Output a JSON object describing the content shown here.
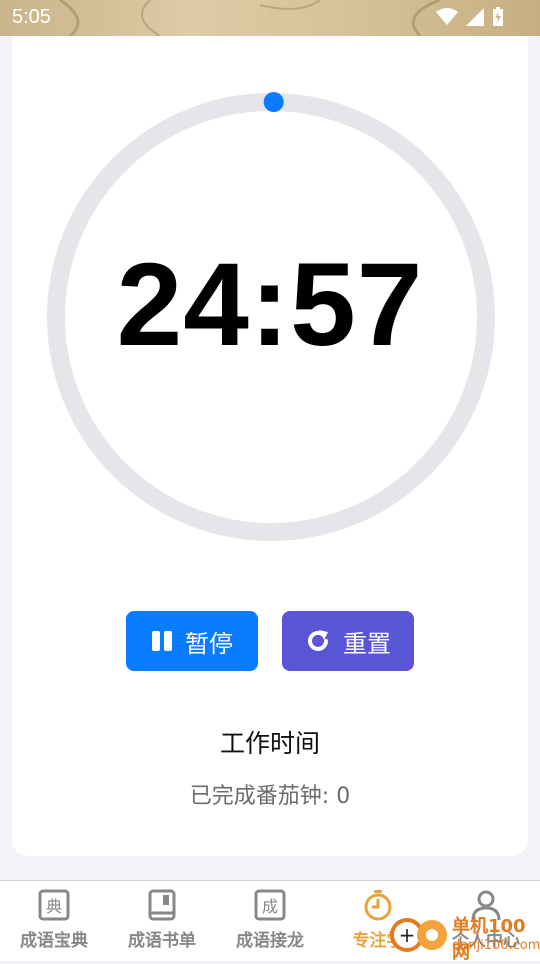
{
  "status_bar": {
    "time": "5:05"
  },
  "timer": {
    "display": "24:57",
    "progress_fraction": 0.002
  },
  "controls": {
    "pause_label": "暂停",
    "reset_label": "重置"
  },
  "session": {
    "mode": "工作时间",
    "completed_text": "已完成番茄钟: 0"
  },
  "nav": {
    "items": [
      {
        "label": "成语宝典",
        "icon": "dictionary-icon"
      },
      {
        "label": "成语书单",
        "icon": "book-icon"
      },
      {
        "label": "成语接龙",
        "icon": "chain-icon"
      },
      {
        "label": "专注学",
        "icon": "timer-icon"
      },
      {
        "label": "个人中心",
        "icon": "person-icon"
      }
    ],
    "active_index": 3
  },
  "watermark": {
    "line1": "单机100网",
    "line2": "danji100.com"
  },
  "colors": {
    "primary": "#0a7cff",
    "reset": "#5856d6",
    "ring_track": "#e5e5ea",
    "active_tab": "#e8a23a"
  }
}
